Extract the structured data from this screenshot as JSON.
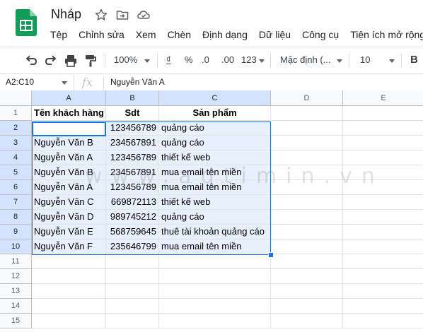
{
  "header": {
    "title": "Nháp",
    "menu": [
      "Tệp",
      "Chỉnh sửa",
      "Xem",
      "Chèn",
      "Định dạng",
      "Dữ liệu",
      "Công cụ",
      "Tiện ích mở rộng"
    ]
  },
  "toolbar": {
    "zoom": "100%",
    "currency": "₫",
    "percent": "%",
    "decrease_decimal": ".0",
    "increase_decimal": ".00",
    "more_formats": "123",
    "font": "Mặc định (...",
    "font_size": "10",
    "bold": "B"
  },
  "formula_bar": {
    "name_box": "A2:C10",
    "fx": "fx",
    "value": "Nguyễn Văn A"
  },
  "grid": {
    "columns": [
      "A",
      "B",
      "C",
      "D",
      "E"
    ],
    "rows": [
      "1",
      "2",
      "3",
      "4",
      "5",
      "6",
      "7",
      "8",
      "9",
      "10",
      "11",
      "12",
      "13",
      "14",
      "15"
    ],
    "header_row": [
      "Tên khách hàng",
      "Sdt",
      "Sản phẩm"
    ],
    "data_rows": [
      [
        "Nguyễn Văn A",
        "123456789",
        "quảng cáo"
      ],
      [
        "Nguyễn Văn B",
        "234567891",
        "quảng cáo"
      ],
      [
        "Nguyễn Văn A",
        "123456789",
        "thiết kế web"
      ],
      [
        "Nguyễn Văn B",
        "234567891",
        "mua email tên miền"
      ],
      [
        "Nguyễn Văn A",
        "123456789",
        "mua email tên miền"
      ],
      [
        "Nguyễn Văn C",
        "669872113",
        "thiết kế web"
      ],
      [
        "Nguyễn Văn D",
        "989745212",
        "quảng cáo"
      ],
      [
        "Nguyễn Văn E",
        "568759645",
        "thuê tài khoản quảng cáo"
      ],
      [
        "Nguyễn Văn F",
        "235646799",
        "mua email tên miền"
      ]
    ]
  },
  "watermark": "www.adtimin.vn",
  "colors": {
    "accent": "#1a73e8",
    "selection_fill": "#e8f0fe",
    "logo_green": "#0f9d58"
  }
}
